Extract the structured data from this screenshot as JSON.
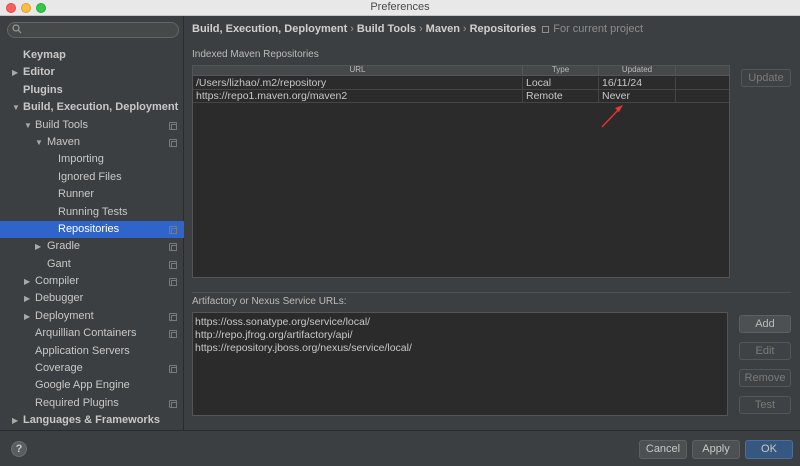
{
  "window": {
    "title": "Preferences"
  },
  "sidebar": {
    "search": {
      "placeholder": ""
    },
    "items": [
      {
        "label": "Keymap",
        "bold": true,
        "arrow": "",
        "indent": 0,
        "icon": false,
        "selected": false
      },
      {
        "label": "Editor",
        "bold": true,
        "arrow": "▶",
        "indent": 0,
        "icon": false,
        "selected": false
      },
      {
        "label": "Plugins",
        "bold": true,
        "arrow": "",
        "indent": 0,
        "icon": false,
        "selected": false
      },
      {
        "label": "Build, Execution, Deployment",
        "bold": true,
        "arrow": "▼",
        "indent": 0,
        "icon": false,
        "selected": false
      },
      {
        "label": "Build Tools",
        "bold": false,
        "arrow": "▼",
        "indent": 1,
        "icon": true,
        "selected": false
      },
      {
        "label": "Maven",
        "bold": false,
        "arrow": "▼",
        "indent": 2,
        "icon": true,
        "selected": false
      },
      {
        "label": "Importing",
        "bold": false,
        "arrow": "",
        "indent": 3,
        "icon": false,
        "selected": false
      },
      {
        "label": "Ignored Files",
        "bold": false,
        "arrow": "",
        "indent": 3,
        "icon": false,
        "selected": false
      },
      {
        "label": "Runner",
        "bold": false,
        "arrow": "",
        "indent": 3,
        "icon": false,
        "selected": false
      },
      {
        "label": "Running Tests",
        "bold": false,
        "arrow": "",
        "indent": 3,
        "icon": false,
        "selected": false
      },
      {
        "label": "Repositories",
        "bold": false,
        "arrow": "",
        "indent": 3,
        "icon": true,
        "selected": true
      },
      {
        "label": "Gradle",
        "bold": false,
        "arrow": "▶",
        "indent": 2,
        "icon": true,
        "selected": false
      },
      {
        "label": "Gant",
        "bold": false,
        "arrow": "",
        "indent": 2,
        "icon": true,
        "selected": false
      },
      {
        "label": "Compiler",
        "bold": false,
        "arrow": "▶",
        "indent": 1,
        "icon": true,
        "selected": false
      },
      {
        "label": "Debugger",
        "bold": false,
        "arrow": "▶",
        "indent": 1,
        "icon": false,
        "selected": false
      },
      {
        "label": "Deployment",
        "bold": false,
        "arrow": "▶",
        "indent": 1,
        "icon": true,
        "selected": false
      },
      {
        "label": "Arquillian Containers",
        "bold": false,
        "arrow": "",
        "indent": 1,
        "icon": true,
        "selected": false
      },
      {
        "label": "Application Servers",
        "bold": false,
        "arrow": "",
        "indent": 1,
        "icon": false,
        "selected": false
      },
      {
        "label": "Coverage",
        "bold": false,
        "arrow": "",
        "indent": 1,
        "icon": true,
        "selected": false
      },
      {
        "label": "Google App Engine",
        "bold": false,
        "arrow": "",
        "indent": 1,
        "icon": false,
        "selected": false
      },
      {
        "label": "Required Plugins",
        "bold": false,
        "arrow": "",
        "indent": 1,
        "icon": true,
        "selected": false
      },
      {
        "label": "Languages & Frameworks",
        "bold": true,
        "arrow": "▶",
        "indent": 0,
        "icon": false,
        "selected": false
      }
    ]
  },
  "breadcrumb": {
    "parts": [
      "Build, Execution, Deployment",
      "Build Tools",
      "Maven",
      "Repositories"
    ],
    "separator": "›",
    "project_note": "For current project"
  },
  "indexed": {
    "label": "Indexed Maven Repositories",
    "columns": [
      "URL",
      "Type",
      "Updated"
    ],
    "rows": [
      {
        "url": "/Users/lizhao/.m2/repository",
        "type": "Local",
        "updated": "16/11/24"
      },
      {
        "url": "https://repo1.maven.org/maven2",
        "type": "Remote",
        "updated": "Never"
      }
    ],
    "update_button": "Update"
  },
  "artifactory": {
    "label": "Artifactory or Nexus Service URLs:",
    "urls": [
      "https://oss.sonatype.org/service/local/",
      "http://repo.jfrog.org/artifactory/api/",
      "https://repository.jboss.org/nexus/service/local/"
    ],
    "buttons": {
      "add": "Add",
      "edit": "Edit",
      "remove": "Remove",
      "test": "Test"
    }
  },
  "footer": {
    "help": "?",
    "cancel": "Cancel",
    "apply": "Apply",
    "ok": "OK"
  },
  "colors": {
    "background": "#3c3f41",
    "selection": "#2f65ca",
    "annotation_arrow": "#e8382c"
  }
}
